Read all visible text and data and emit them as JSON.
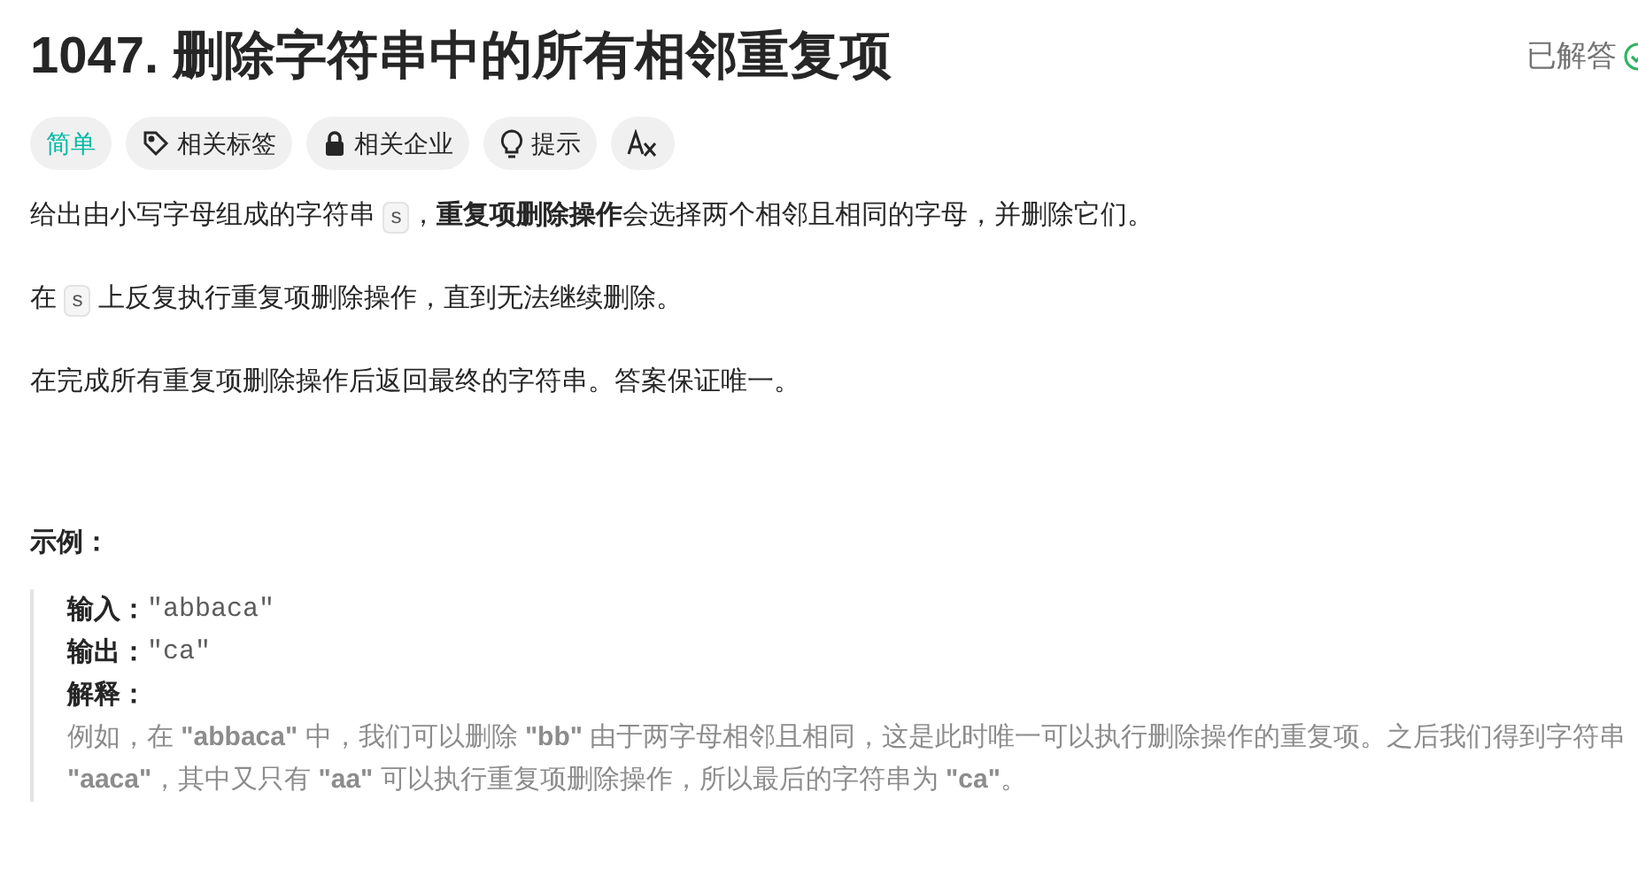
{
  "title": "1047. 删除字符串中的所有相邻重复项",
  "status": {
    "text": "已解答",
    "solved": true
  },
  "tags": [
    {
      "kind": "difficulty",
      "label": "简单"
    },
    {
      "kind": "tag",
      "label": "相关标签"
    },
    {
      "kind": "lock",
      "label": "相关企业"
    },
    {
      "kind": "hint",
      "label": "提示"
    },
    {
      "kind": "translate"
    }
  ],
  "paragraphs": [
    [
      {
        "kind": "text",
        "text": "给出由小写字母组成的字符串 "
      },
      {
        "kind": "code",
        "text": "s"
      },
      {
        "kind": "text",
        "text": "，**重复项删除操作**会选择两个相邻且相同的字母，并删除它们。"
      }
    ],
    [
      {
        "kind": "text",
        "text": "在 "
      },
      {
        "kind": "code",
        "text": "s"
      },
      {
        "kind": "text",
        "text": " 上反复执行重复项删除操作，直到无法继续删除。"
      }
    ],
    [
      {
        "kind": "text",
        "text": "在完成所有重复项删除操作后返回最终的字符串。答案保证唯一。"
      }
    ]
  ],
  "example": {
    "heading": "示例：",
    "lines": [
      {
        "label": "输入：",
        "value": "\"abbaca\""
      },
      {
        "label": "输出：",
        "value": "\"ca\""
      },
      {
        "label": "解释："
      }
    ],
    "explanation": "例如，在 **\"abbaca\"** 中，我们可以删除 **\"bb\"** 由于两字母相邻且相同，这是此时唯一可以执行删除操作的重复项。之后我们得到字符串 **\"aaca\"**，其中又只有 **\"aa\"** 可以执行重复项删除操作，所以最后的字符串为 **\"ca\"**。"
  }
}
